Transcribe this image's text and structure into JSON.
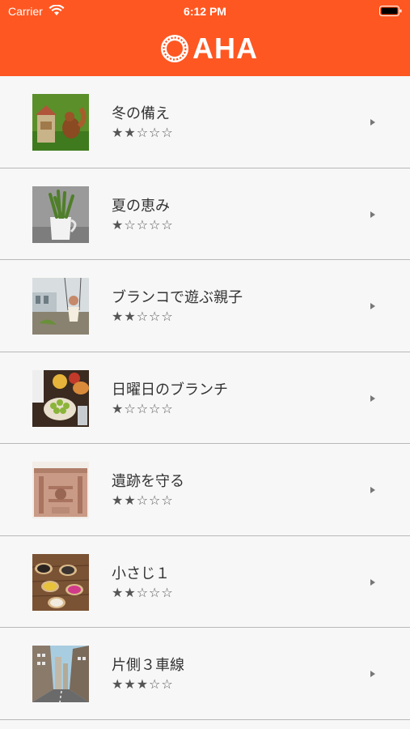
{
  "status_bar": {
    "carrier": "Carrier",
    "time": "6:12 PM"
  },
  "header": {
    "logo_text": "AHA",
    "color": "#ff5722"
  },
  "items": [
    {
      "title": "冬の備え",
      "stars": "★★☆☆☆",
      "rating": 2,
      "thumb": "squirrel-feeder"
    },
    {
      "title": "夏の恵み",
      "stars": "★☆☆☆☆",
      "rating": 1,
      "thumb": "asparagus-pitcher"
    },
    {
      "title": "ブランコで遊ぶ親子",
      "stars": "★★☆☆☆",
      "rating": 2,
      "thumb": "swing-park"
    },
    {
      "title": "日曜日のブランチ",
      "stars": "★☆☆☆☆",
      "rating": 1,
      "thumb": "brunch-table"
    },
    {
      "title": "遺跡を守る",
      "stars": "★★☆☆☆",
      "rating": 2,
      "thumb": "ruins-carving"
    },
    {
      "title": "小さじ１",
      "stars": "★★☆☆☆",
      "rating": 2,
      "thumb": "spoons-spices"
    },
    {
      "title": "片側３車線",
      "stars": "★★★☆☆",
      "rating": 3,
      "thumb": "city-street"
    }
  ]
}
